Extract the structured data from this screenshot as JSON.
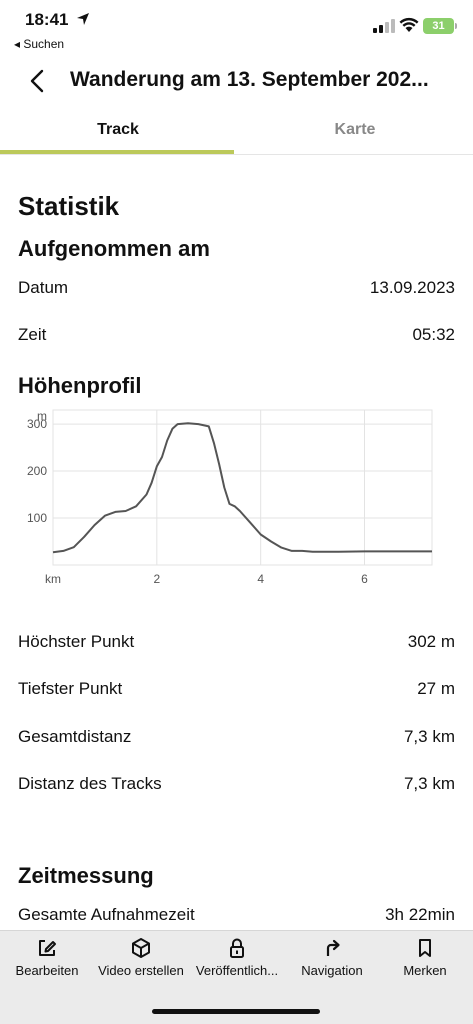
{
  "status_bar": {
    "time": "18:41",
    "back_app": "◂ Suchen",
    "battery": "31"
  },
  "header": {
    "title": "Wanderung am 13. September 202..."
  },
  "tabs": [
    {
      "label": "Track"
    },
    {
      "label": "Karte"
    }
  ],
  "stats": {
    "heading": "Statistik",
    "recorded": {
      "heading": "Aufgenommen am",
      "date_label": "Datum",
      "date_value": "13.09.2023",
      "time_label": "Zeit",
      "time_value": "05:32"
    },
    "profile": {
      "heading": "Höhenprofil",
      "highest_label": "Höchster Punkt",
      "highest_value": "302 m",
      "lowest_label": "Tiefster Punkt",
      "lowest_value": "27 m",
      "total_label": "Gesamtdistanz",
      "total_value": "7,3 km",
      "track_label": "Distanz des Tracks",
      "track_value": "7,3 km"
    },
    "timing": {
      "heading": "Zeitmessung",
      "total_time_label": "Gesamte Aufnahmezeit",
      "total_time_value": "3h 22min"
    }
  },
  "chart_data": {
    "type": "area",
    "xlabel": "km",
    "ylabel": "m",
    "x_ticks": [
      2,
      4,
      6
    ],
    "y_ticks": [
      100,
      200,
      300
    ],
    "xlim": [
      0,
      7.3
    ],
    "ylim": [
      0,
      330
    ],
    "grid": true,
    "color": "#555555",
    "x": [
      0,
      0.2,
      0.4,
      0.6,
      0.8,
      1.0,
      1.2,
      1.4,
      1.6,
      1.8,
      1.9,
      2.0,
      2.1,
      2.2,
      2.3,
      2.4,
      2.6,
      2.8,
      3.0,
      3.1,
      3.2,
      3.3,
      3.4,
      3.5,
      3.6,
      3.8,
      4.0,
      4.2,
      4.4,
      4.6,
      4.8,
      5.0,
      5.5,
      6.0,
      7.3
    ],
    "y": [
      27,
      30,
      38,
      60,
      85,
      105,
      113,
      115,
      125,
      150,
      175,
      210,
      230,
      265,
      290,
      300,
      302,
      300,
      295,
      260,
      215,
      165,
      130,
      125,
      115,
      90,
      65,
      50,
      37,
      30,
      30,
      28,
      28,
      29,
      29
    ]
  },
  "bottom_bar": {
    "edit": "Bearbeiten",
    "video": "Video erstellen",
    "publish": "Veröffentlich...",
    "navigation": "Navigation",
    "bookmark": "Merken"
  }
}
